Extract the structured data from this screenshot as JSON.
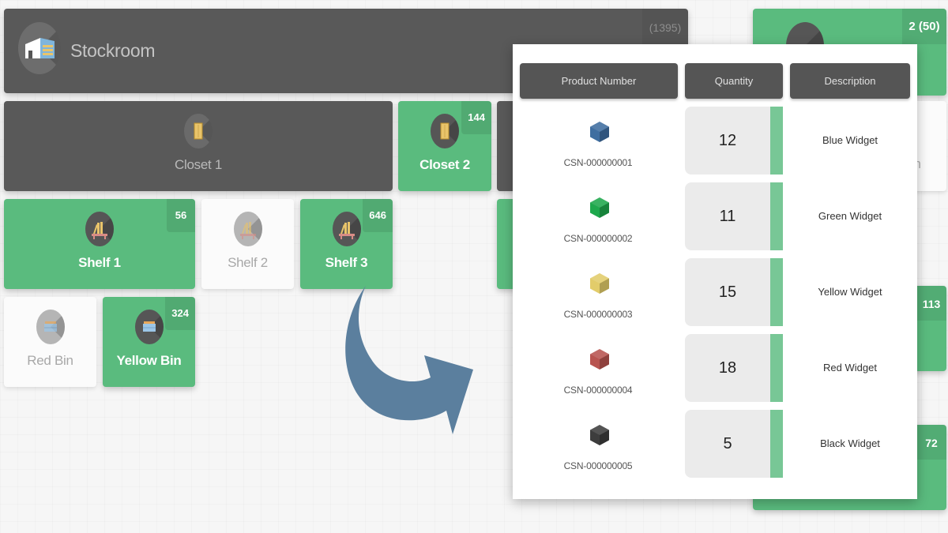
{
  "stockroom": {
    "title": "Stockroom",
    "count": "(1395)",
    "icon": "warehouse-icon"
  },
  "right_header_tile": {
    "count": "2 (50)",
    "color": "#5abb7e"
  },
  "closets": [
    {
      "label": "Closet 1",
      "count": "",
      "state": "dark",
      "icon": "door-icon"
    },
    {
      "label": "Closet 2",
      "count": "144",
      "state": "green",
      "icon": "door-icon"
    }
  ],
  "shelves": [
    {
      "label": "Shelf 1",
      "count": "56",
      "state": "green",
      "icon": "bookshelf-icon"
    },
    {
      "label": "Shelf 2",
      "count": "",
      "state": "white",
      "icon": "bookshelf-icon"
    },
    {
      "label": "Shelf 3",
      "count": "646",
      "state": "green",
      "icon": "bookshelf-icon"
    }
  ],
  "bins": [
    {
      "label": "Red Bin",
      "count": "",
      "state": "white",
      "icon": "bin-icon"
    },
    {
      "label": "Yellow Bin",
      "count": "324",
      "state": "green",
      "icon": "bin-icon"
    }
  ],
  "right_column_tiles": [
    {
      "count": "113"
    },
    {
      "count": "72"
    }
  ],
  "colors": {
    "dark_tile": "#595959",
    "green_tile": "#5abb7e",
    "arrow": "#5b7f9e",
    "qty_bar": "#78c796"
  },
  "inventory_table": {
    "headers": {
      "product_number": "Product Number",
      "quantity": "Quantity",
      "description": "Description"
    },
    "rows": [
      {
        "product_number": "CSN-000000001",
        "quantity": "12",
        "description": "Blue Widget",
        "cube_color": "#3f6ea0",
        "icon": "blue-cube-icon"
      },
      {
        "product_number": "CSN-000000002",
        "quantity": "11",
        "description": "Green Widget",
        "cube_color": "#1ea84c",
        "icon": "green-cube-icon"
      },
      {
        "product_number": "CSN-000000003",
        "quantity": "15",
        "description": "Yellow Widget",
        "cube_color": "#e2cc6a",
        "icon": "yellow-cube-icon"
      },
      {
        "product_number": "CSN-000000004",
        "quantity": "18",
        "description": "Red Widget",
        "cube_color": "#b85450",
        "icon": "red-cube-icon"
      },
      {
        "product_number": "CSN-000000005",
        "quantity": "5",
        "description": "Black Widget",
        "cube_color": "#3d3d3d",
        "icon": "black-cube-icon"
      }
    ]
  }
}
